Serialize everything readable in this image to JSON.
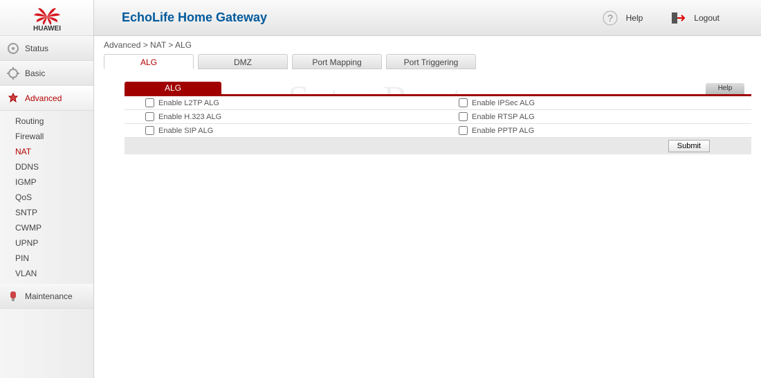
{
  "brand": "HUAWEI",
  "header": {
    "title": "EchoLife Home Gateway",
    "help": "Help",
    "logout": "Logout"
  },
  "breadcrumb": "Advanced > NAT > ALG",
  "tabs": [
    "ALG",
    "DMZ",
    "Port Mapping",
    "Port Triggering"
  ],
  "active_tab": "ALG",
  "sidebar": {
    "sections": [
      {
        "label": "Status",
        "active": false
      },
      {
        "label": "Basic",
        "active": false
      },
      {
        "label": "Advanced",
        "active": true
      },
      {
        "label": "Maintenance",
        "active": false
      }
    ],
    "sub": [
      "Routing",
      "Firewall",
      "NAT",
      "DDNS",
      "IGMP",
      "QoS",
      "SNTP",
      "CWMP",
      "UPNP",
      "PIN",
      "VLAN"
    ],
    "sub_active": "NAT"
  },
  "panel": {
    "title": "ALG",
    "help": "Help",
    "rows": [
      {
        "left": "Enable L2TP ALG",
        "right": "Enable IPSec ALG"
      },
      {
        "left": "Enable H.323 ALG",
        "right": "Enable RTSP ALG"
      },
      {
        "left": "Enable SIP ALG",
        "right": "Enable PPTP ALG"
      }
    ],
    "submit": "Submit"
  },
  "watermark": "SetupRouter.co"
}
